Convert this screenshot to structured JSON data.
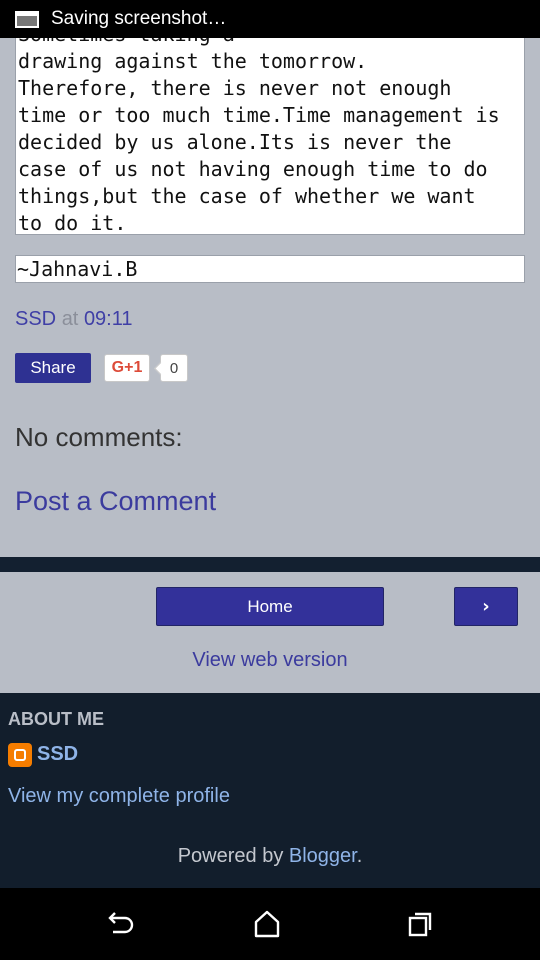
{
  "status_bar": {
    "notification_text": "Saving screenshot…"
  },
  "post": {
    "body_lines": [
      "Sometimes taking a",
      "drawing against the tomorrow.",
      "Therefore, there is never not enough",
      "time or too much time.Time management is",
      "decided by us alone.Its is never the",
      "case of us not having enough time to do",
      "things,but the case of whether we want",
      "to do it."
    ],
    "signature": "~Jahnavi.B",
    "author": "SSD",
    "at_word": "at",
    "time": "09:11"
  },
  "share": {
    "share_label": "Share",
    "gplus_label": "G+1",
    "gplus_count": "0"
  },
  "comments": {
    "heading": "No comments:",
    "post_comment_label": "Post a Comment"
  },
  "pager": {
    "home_label": "Home",
    "next_label": "›",
    "web_version_label": "View web version"
  },
  "footer": {
    "about_heading": "ABOUT ME",
    "profile_name": "SSD",
    "profile_link_label": "View my complete profile",
    "powered_prefix": "Powered by ",
    "powered_link": "Blogger",
    "powered_suffix": "."
  },
  "colors": {
    "accent": "#33319a",
    "link": "#3b3b9e",
    "footer_bg": "#121e2c",
    "page_bg": "#b8bdc6",
    "blogger_orange": "#f57d00"
  },
  "icons": [
    "screenshot-icon",
    "blogger-icon",
    "back-icon",
    "home-icon",
    "recents-icon"
  ]
}
